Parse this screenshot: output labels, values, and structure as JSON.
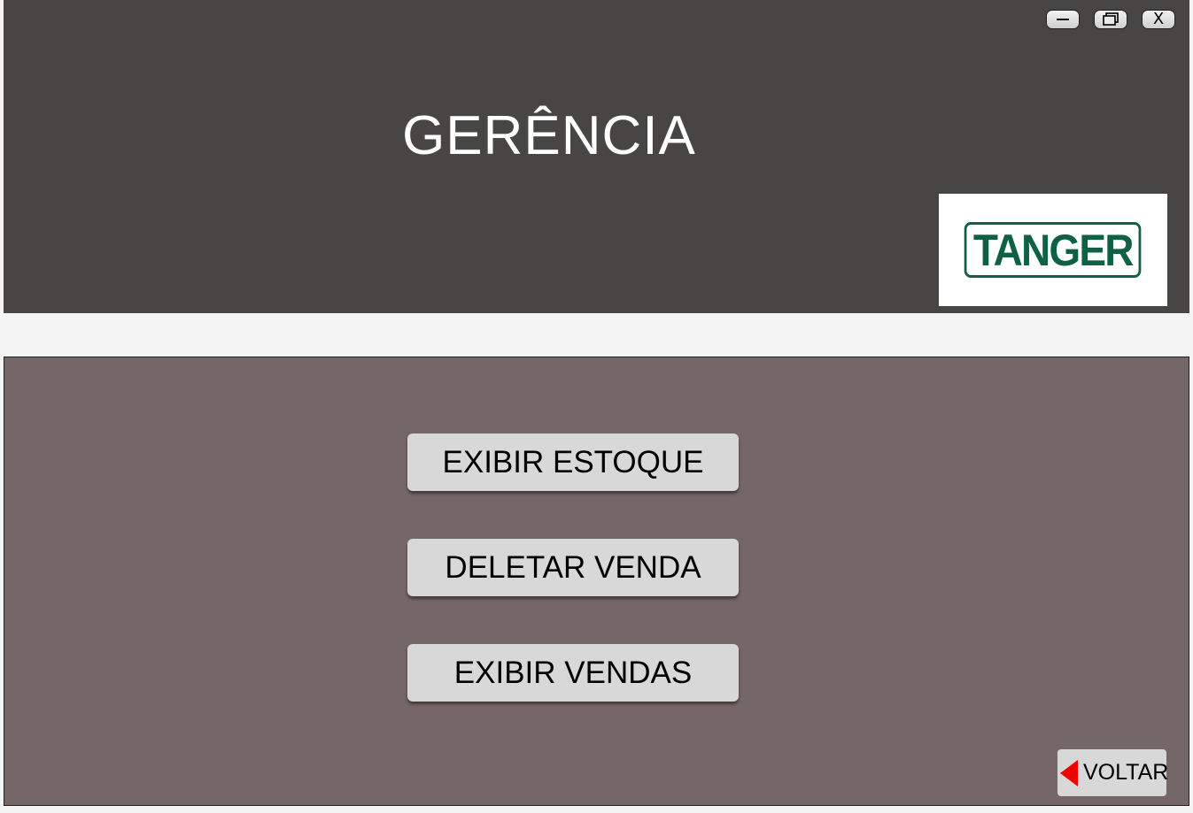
{
  "window_controls": {
    "minimize_label": "",
    "maximize_label": "",
    "close_label": "X"
  },
  "header": {
    "title": "GERÊNCIA",
    "background_color": "#484644",
    "logo_text": "TANGER",
    "logo_color": "#0e6142"
  },
  "main": {
    "background_color": "#756767",
    "buttons": [
      {
        "label": "EXIBIR ESTOQUE"
      },
      {
        "label": "DELETAR VENDA"
      },
      {
        "label": "EXIBIR VENDAS"
      }
    ],
    "back_button": {
      "label": "VOLTAR",
      "icon": "left-arrow-icon",
      "icon_color": "#ee0000"
    }
  }
}
